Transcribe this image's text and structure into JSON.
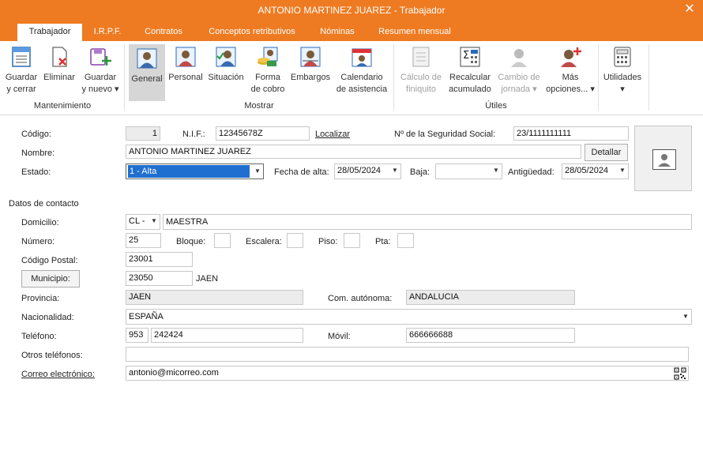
{
  "window": {
    "title": "ANTONIO MARTINEZ JUAREZ - Trabajador",
    "close_glyph": "✕"
  },
  "tabs": [
    "Trabajador",
    "I.R.P.F.",
    "Contratos",
    "Conceptos retributivos",
    "Nóminas",
    "Resumen mensual"
  ],
  "ribbon": {
    "buttons": [
      {
        "l1": "Guardar",
        "l2": "y cerrar"
      },
      {
        "l1": "Eliminar",
        "l2": ""
      },
      {
        "l1": "Guardar",
        "l2": "y nuevo ▾"
      },
      {
        "l1": "General",
        "l2": ""
      },
      {
        "l1": "Personal",
        "l2": ""
      },
      {
        "l1": "Situación",
        "l2": ""
      },
      {
        "l1": "Forma",
        "l2": "de cobro"
      },
      {
        "l1": "Embargos",
        "l2": ""
      },
      {
        "l1": "Calendario",
        "l2": "de asistencia"
      },
      {
        "l1": "Cálculo de",
        "l2": "finiquito"
      },
      {
        "l1": "Recalcular",
        "l2": "acumulado"
      },
      {
        "l1": "Cambio de",
        "l2": "jornada ▾"
      },
      {
        "l1": "Más",
        "l2": "opciones... ▾"
      },
      {
        "l1": "Utilidades",
        "l2": "▾"
      }
    ],
    "groups": [
      "Mantenimiento",
      "Mostrar",
      "Útiles"
    ]
  },
  "form": {
    "codigo_label": "Código:",
    "codigo": "1",
    "nif_label": "N.I.F.:",
    "nif": "12345678Z",
    "localizar": "Localizar",
    "nss_label": "Nº de la Seguridad Social:",
    "nss": "23/1111111111",
    "nombre_label": "Nombre:",
    "nombre": "ANTONIO MARTINEZ JUAREZ",
    "detallar": "Detallar",
    "estado_label": "Estado:",
    "estado": "1 - Alta",
    "fecha_alta_label": "Fecha de alta:",
    "fecha_alta": "28/05/2024",
    "baja_label": "Baja:",
    "baja": "",
    "antiguedad_label": "Antigüedad:",
    "antiguedad": "28/05/2024",
    "contacto_heading": "Datos de contacto",
    "domicilio_label": "Domicilio:",
    "via": "CL -",
    "domicilio": "MAESTRA",
    "numero_label": "Número:",
    "numero": "25",
    "bloque_label": "Bloque:",
    "escalera_label": "Escalera:",
    "piso_label": "Piso:",
    "pta_label": "Pta:",
    "cp_label": "Código Postal:",
    "cp": "23001",
    "municipio_btn": "Municipio:",
    "municipio_code": "23050",
    "municipio": "JAEN",
    "provincia_label": "Provincia:",
    "provincia": "JAEN",
    "comunidad_label": "Com. autónoma:",
    "comunidad": "ANDALUCIA",
    "nacionalidad_label": "Nacionalidad:",
    "nacionalidad": "ESPAÑA",
    "telefono_label": "Teléfono:",
    "tel_prefijo": "953",
    "telefono": "242424",
    "movil_label": "Móvil:",
    "movil": "666666688",
    "otros_label": "Otros teléfonos:",
    "correo_label": "Correo electrónico:",
    "correo": "antonio@micorreo.com"
  },
  "colors": {
    "accent": "#ee7b22",
    "selection": "#1f6fd0"
  }
}
